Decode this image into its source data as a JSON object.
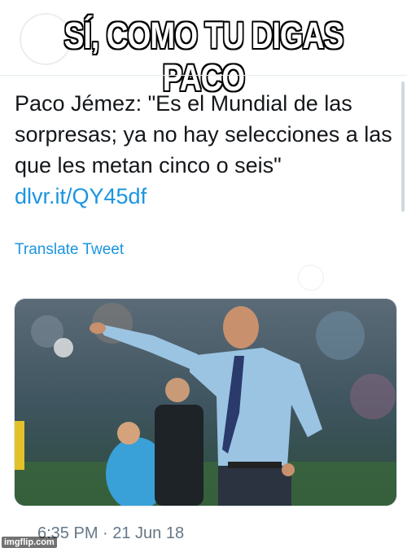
{
  "meme": {
    "caption": "SÍ, COMO TU DIGAS PACO"
  },
  "tweet": {
    "text": "Paco Jémez: \"Es el Mundial de las sorpresas; ya no hay selecciones a las que les metan cinco o seis\"",
    "link": "dlvr.it/QY45df",
    "translate_label": "Translate Tweet",
    "timestamp": "6:35 PM · 21 Jun 18"
  },
  "media": {
    "icon": "photo-coach-pointing"
  },
  "watermark": {
    "text": "imgflip.com"
  },
  "colors": {
    "link": "#1b95e0",
    "text": "#14171a",
    "muted": "#657786"
  }
}
